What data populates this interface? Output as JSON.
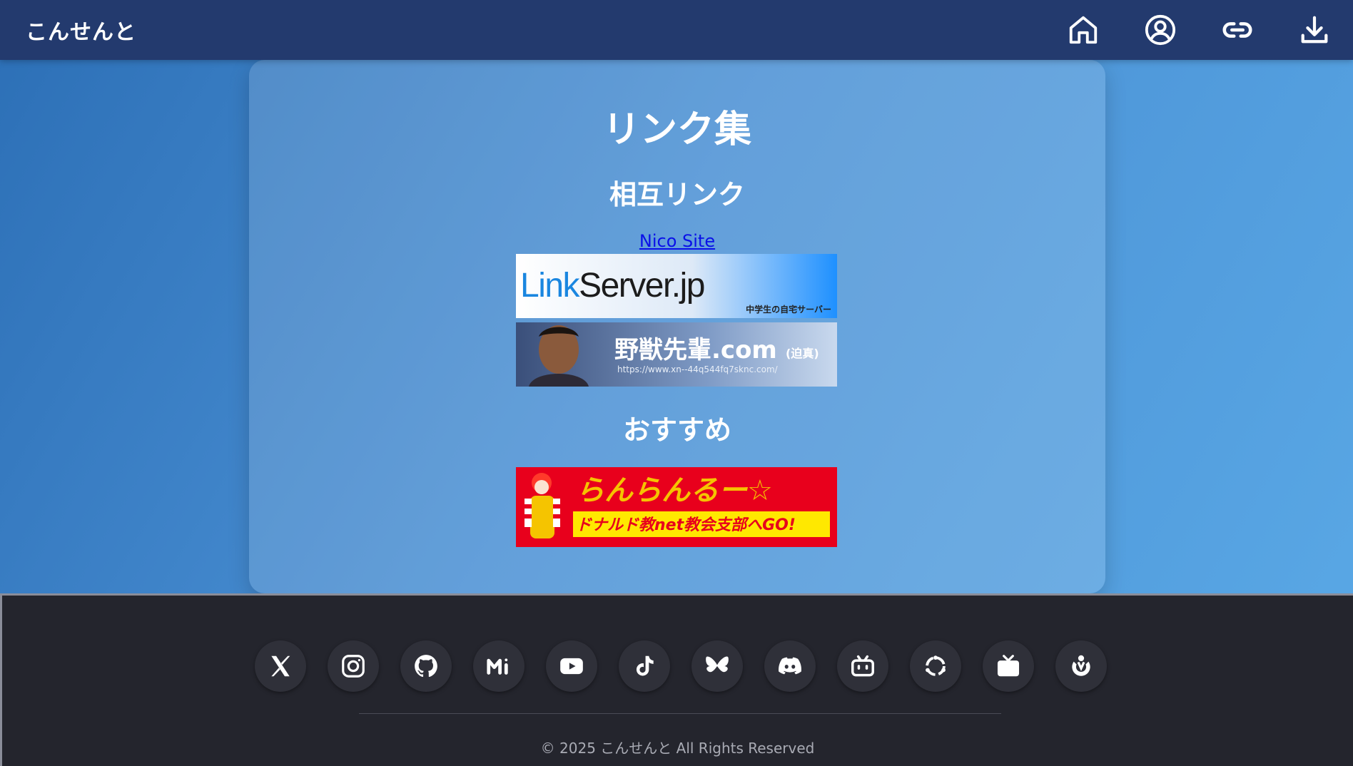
{
  "header": {
    "brand": "こんせんと",
    "nav": [
      {
        "icon": "home-icon"
      },
      {
        "icon": "user-icon"
      },
      {
        "icon": "link-icon"
      },
      {
        "icon": "download-icon"
      }
    ],
    "background": "#233a6e"
  },
  "main": {
    "title": "リンク集",
    "sections": {
      "mutual": {
        "title": "相互リンク",
        "link_text": "Nico Site",
        "banners": [
          {
            "name": "linkserver-banner",
            "text": "LinkServer.jp",
            "text_accent": "Link",
            "text_rest": "Server.jp",
            "subtext": "中学生の自宅サーバー"
          },
          {
            "name": "yaju-banner",
            "text": "野獣先輩.com",
            "suffix": "(迫真)",
            "url": "https://www.xn--44q544fq7sknc.com/"
          }
        ]
      },
      "recommended": {
        "title": "おすすめ",
        "banners": [
          {
            "name": "donald-banner",
            "headline": "らんらんるー☆",
            "subline": "ドナルド教net教会支部へGO!"
          }
        ]
      }
    }
  },
  "footer": {
    "social": [
      {
        "icon": "x-icon"
      },
      {
        "icon": "instagram-icon"
      },
      {
        "icon": "github-icon"
      },
      {
        "icon": "misskey-icon"
      },
      {
        "icon": "youtube-icon"
      },
      {
        "icon": "tiktok-icon"
      },
      {
        "icon": "bluesky-icon"
      },
      {
        "icon": "discord-icon"
      },
      {
        "icon": "bilibili-icon"
      },
      {
        "icon": "fediverse-icon"
      },
      {
        "icon": "tv-icon"
      },
      {
        "icon": "wikimedia-icon"
      }
    ],
    "copyright": "© 2025 こんせんと All Rights Reserved"
  },
  "colors": {
    "accent": "#5aa9e6",
    "link": "#0a10e8",
    "footer_bg": "#24252d"
  }
}
